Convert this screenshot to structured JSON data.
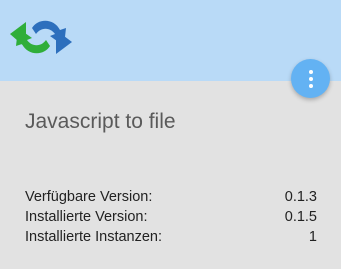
{
  "adapter": {
    "icon": "refresh-arrows-icon",
    "title": "Javascript to file"
  },
  "menu": {
    "icon": "more-vertical-icon"
  },
  "info": [
    {
      "label": "Verfügbare Version:",
      "value": "0.1.3"
    },
    {
      "label": "Installierte Version:",
      "value": "0.1.5"
    },
    {
      "label": "Installierte Instanzen:",
      "value": "1"
    }
  ],
  "colors": {
    "header": "#b9daf7",
    "card": "#e2e2e2",
    "accent": "#63b2f3",
    "icon_green": "#2fae3a",
    "icon_blue": "#2d6fbd"
  }
}
